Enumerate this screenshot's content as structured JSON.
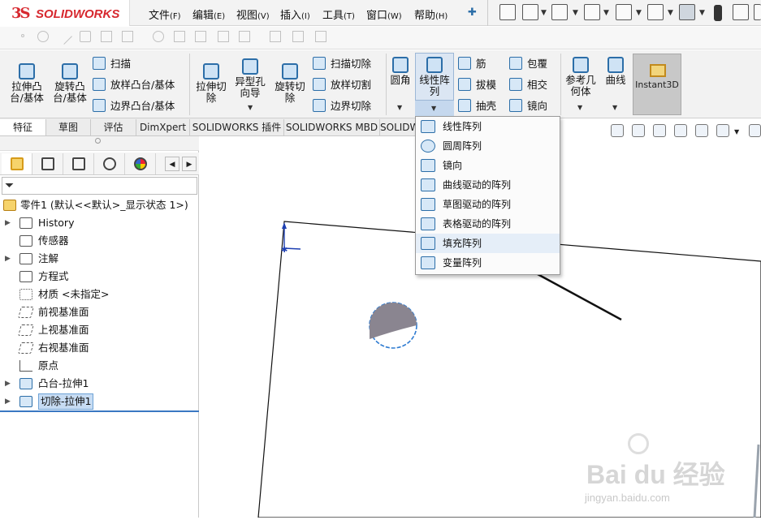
{
  "app": {
    "logo_prefix": "3S",
    "logo_text": "SOLIDWORKS"
  },
  "menu": [
    {
      "label": "文件",
      "key": "(F)"
    },
    {
      "label": "编辑",
      "key": "(E)"
    },
    {
      "label": "视图",
      "key": "(V)"
    },
    {
      "label": "插入",
      "key": "(I)"
    },
    {
      "label": "工具",
      "key": "(T)"
    },
    {
      "label": "窗口",
      "key": "(W)"
    },
    {
      "label": "帮助",
      "key": "(H)"
    }
  ],
  "quick_access_icons": [
    "pin-icon",
    "home-icon",
    "new-document-icon",
    "open-icon",
    "save-icon",
    "print-icon",
    "undo-icon",
    "select-icon",
    "traffic-light-icon",
    "file-properties-icon",
    "options-icon"
  ],
  "features": {
    "extrude_boss": "拉伸凸台/基体",
    "revolve_boss": "旋转凸台/基体",
    "sweep": "扫描",
    "loft_boss": "放样凸台/基体",
    "boundary_boss": "边界凸台/基体",
    "extrude_cut": "拉伸切除",
    "hole_wizard": "异型孔向导",
    "revolve_cut": "旋转切除",
    "swept_cut": "扫描切除",
    "lofted_cut": "放样切割",
    "boundary_cut": "边界切除",
    "fillet": "圆角",
    "linear_pattern": "线性阵列",
    "rib": "筋",
    "draft": "拔模",
    "shell": "抽壳",
    "wrap": "包覆",
    "intersect": "相交",
    "mirror": "镜向",
    "reference_geometry": "参考几何体",
    "curves": "曲线",
    "instant3d": "Instant3D"
  },
  "tabs": [
    "特征",
    "草图",
    "评估",
    "DimXpert",
    "SOLIDWORKS 插件",
    "SOLIDWORKS MBD",
    "SOLIDW"
  ],
  "tree": {
    "root": "零件1  (默认<<默认>_显示状态 1>)",
    "items": [
      {
        "label": "History",
        "icon": "history-icon",
        "expand": true
      },
      {
        "label": "传感器",
        "icon": "sensor-icon",
        "expand": false
      },
      {
        "label": "注解",
        "icon": "annotation-icon",
        "expand": true
      },
      {
        "label": "方程式",
        "icon": "equation-icon",
        "expand": false
      },
      {
        "label": "材质 <未指定>",
        "icon": "material-icon",
        "expand": false
      },
      {
        "label": "前视基准面",
        "icon": "plane-icon",
        "expand": false
      },
      {
        "label": "上视基准面",
        "icon": "plane-icon",
        "expand": false
      },
      {
        "label": "右视基准面",
        "icon": "plane-icon",
        "expand": false
      },
      {
        "label": "原点",
        "icon": "origin-icon",
        "expand": false
      },
      {
        "label": "凸台-拉伸1",
        "icon": "boss-extrude-icon",
        "expand": true
      },
      {
        "label": "切除-拉伸1",
        "icon": "cut-extrude-icon",
        "expand": true
      }
    ]
  },
  "pattern_menu": [
    {
      "label": "线性阵列",
      "icon": "linear-pattern-icon"
    },
    {
      "label": "圆周阵列",
      "icon": "circular-pattern-icon"
    },
    {
      "label": "镜向",
      "icon": "mirror-icon"
    },
    {
      "label": "曲线驱动的阵列",
      "icon": "curve-driven-pattern-icon"
    },
    {
      "label": "草图驱动的阵列",
      "icon": "sketch-driven-pattern-icon"
    },
    {
      "label": "表格驱动的阵列",
      "icon": "table-driven-pattern-icon"
    },
    {
      "label": "填充阵列",
      "icon": "fill-pattern-icon"
    },
    {
      "label": "变量阵列",
      "icon": "variable-pattern-icon"
    }
  ],
  "watermark": {
    "line1": "Bai du 经验",
    "line2": "jingyan.baidu.com"
  }
}
